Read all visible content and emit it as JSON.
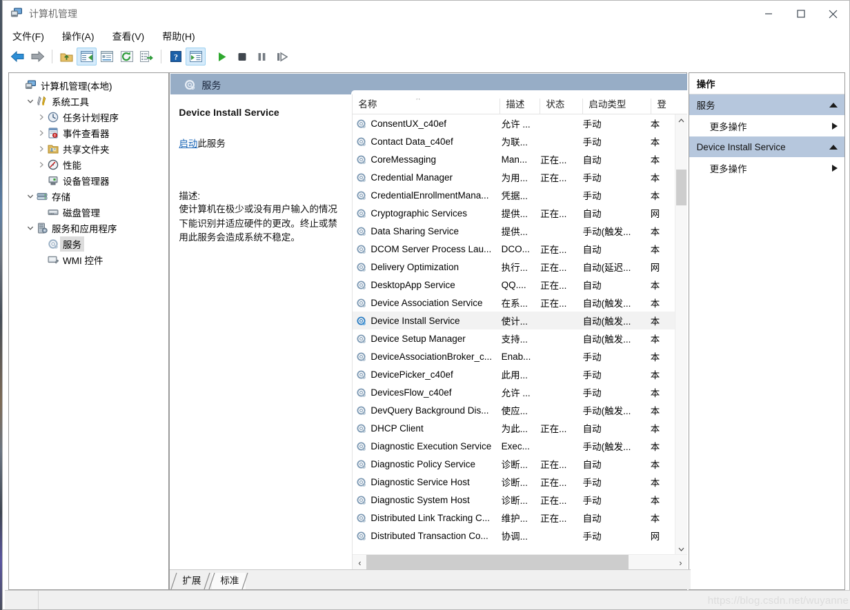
{
  "window": {
    "title": "计算机管理",
    "icon": "computer-management-icon",
    "controls": {
      "minimize": "最小化",
      "maximize": "最大化",
      "close": "关闭"
    }
  },
  "menubar": [
    {
      "label": "文件(F)",
      "name": "menu-file"
    },
    {
      "label": "操作(A)",
      "name": "menu-action"
    },
    {
      "label": "查看(V)",
      "name": "menu-view"
    },
    {
      "label": "帮助(H)",
      "name": "menu-help"
    }
  ],
  "toolbar": [
    {
      "name": "back-icon",
      "title": "后退"
    },
    {
      "name": "forward-icon",
      "title": "前进"
    },
    {
      "name": "up-folder-icon",
      "title": "向上一级"
    },
    {
      "name": "show-tree-icon",
      "title": "显示/隐藏控制台树",
      "pressed": true
    },
    {
      "name": "properties-icon",
      "title": "属性"
    },
    {
      "name": "refresh-icon",
      "title": "刷新"
    },
    {
      "name": "export-list-icon",
      "title": "导出列表"
    },
    {
      "name": "help-icon",
      "title": "帮助"
    },
    {
      "name": "show-action-pane-icon",
      "title": "显示/隐藏操作窗格",
      "pressed": true
    },
    {
      "name": "start-service-icon",
      "title": "启动服务"
    },
    {
      "name": "stop-service-icon",
      "title": "停止服务"
    },
    {
      "name": "pause-service-icon",
      "title": "暂停服务"
    },
    {
      "name": "restart-service-icon",
      "title": "重启服务"
    }
  ],
  "tree": [
    {
      "label": "计算机管理(本地)",
      "level": 0,
      "twist": "none",
      "icon": "computer-icon",
      "selected": false
    },
    {
      "label": "系统工具",
      "level": 1,
      "twist": "expanded",
      "icon": "system-tools-icon",
      "selected": false
    },
    {
      "label": "任务计划程序",
      "level": 2,
      "twist": "collapsed",
      "icon": "task-scheduler-icon",
      "selected": false
    },
    {
      "label": "事件查看器",
      "level": 2,
      "twist": "collapsed",
      "icon": "event-viewer-icon",
      "selected": false
    },
    {
      "label": "共享文件夹",
      "level": 2,
      "twist": "collapsed",
      "icon": "shared-folders-icon",
      "selected": false
    },
    {
      "label": "性能",
      "level": 2,
      "twist": "collapsed",
      "icon": "performance-icon",
      "selected": false
    },
    {
      "label": "设备管理器",
      "level": 2,
      "twist": "none",
      "icon": "device-manager-icon",
      "selected": false
    },
    {
      "label": "存储",
      "level": 1,
      "twist": "expanded",
      "icon": "storage-icon",
      "selected": false
    },
    {
      "label": "磁盘管理",
      "level": 2,
      "twist": "none",
      "icon": "disk-management-icon",
      "selected": false
    },
    {
      "label": "服务和应用程序",
      "level": 1,
      "twist": "expanded",
      "icon": "services-apps-icon",
      "selected": false
    },
    {
      "label": "服务",
      "level": 2,
      "twist": "none",
      "icon": "services-icon",
      "selected": true
    },
    {
      "label": "WMI 控件",
      "level": 2,
      "twist": "none",
      "icon": "wmi-control-icon",
      "selected": false
    }
  ],
  "center": {
    "band_title": "服务",
    "detail": {
      "service_name": "Device Install Service",
      "action_link": "启动",
      "action_suffix": "此服务",
      "desc_header": "描述:",
      "desc_body": "使计算机在极少或没有用户输入的情况下能识别并适应硬件的更改。终止或禁用此服务会造成系统不稳定。"
    },
    "columns": [
      "名称",
      "描述",
      "状态",
      "启动类型",
      "登"
    ],
    "sort": {
      "column": "名称",
      "direction": "ascending",
      "marker": "^"
    },
    "rows": [
      {
        "name": "ConsentUX_c40ef",
        "desc": "允许 ...",
        "status": "",
        "startup": "手动",
        "logon": "本",
        "selected": false
      },
      {
        "name": "Contact Data_c40ef",
        "desc": "为联...",
        "status": "",
        "startup": "手动",
        "logon": "本",
        "selected": false
      },
      {
        "name": "CoreMessaging",
        "desc": "Man...",
        "status": "正在...",
        "startup": "自动",
        "logon": "本",
        "selected": false
      },
      {
        "name": "Credential Manager",
        "desc": "为用...",
        "status": "正在...",
        "startup": "手动",
        "logon": "本",
        "selected": false
      },
      {
        "name": "CredentialEnrollmentMana...",
        "desc": "凭据...",
        "status": "",
        "startup": "手动",
        "logon": "本",
        "selected": false
      },
      {
        "name": "Cryptographic Services",
        "desc": "提供...",
        "status": "正在...",
        "startup": "自动",
        "logon": "网",
        "selected": false
      },
      {
        "name": "Data Sharing Service",
        "desc": "提供...",
        "status": "",
        "startup": "手动(触发...",
        "logon": "本",
        "selected": false
      },
      {
        "name": "DCOM Server Process Lau...",
        "desc": "DCO...",
        "status": "正在...",
        "startup": "自动",
        "logon": "本",
        "selected": false
      },
      {
        "name": "Delivery Optimization",
        "desc": "执行...",
        "status": "正在...",
        "startup": "自动(延迟...",
        "logon": "网",
        "selected": false
      },
      {
        "name": "DesktopApp Service",
        "desc": "QQ....",
        "status": "正在...",
        "startup": "自动",
        "logon": "本",
        "selected": false
      },
      {
        "name": "Device Association Service",
        "desc": "在系...",
        "status": "正在...",
        "startup": "自动(触发...",
        "logon": "本",
        "selected": false
      },
      {
        "name": "Device Install Service",
        "desc": "使计...",
        "status": "",
        "startup": "自动(触发...",
        "logon": "本",
        "selected": true
      },
      {
        "name": "Device Setup Manager",
        "desc": "支持...",
        "status": "",
        "startup": "自动(触发...",
        "logon": "本",
        "selected": false
      },
      {
        "name": "DeviceAssociationBroker_c...",
        "desc": "Enab...",
        "status": "",
        "startup": "手动",
        "logon": "本",
        "selected": false
      },
      {
        "name": "DevicePicker_c40ef",
        "desc": "此用...",
        "status": "",
        "startup": "手动",
        "logon": "本",
        "selected": false
      },
      {
        "name": "DevicesFlow_c40ef",
        "desc": "允许 ...",
        "status": "",
        "startup": "手动",
        "logon": "本",
        "selected": false
      },
      {
        "name": "DevQuery Background Dis...",
        "desc": "使应...",
        "status": "",
        "startup": "手动(触发...",
        "logon": "本",
        "selected": false
      },
      {
        "name": "DHCP Client",
        "desc": "为此...",
        "status": "正在...",
        "startup": "自动",
        "logon": "本",
        "selected": false
      },
      {
        "name": "Diagnostic Execution Service",
        "desc": "Exec...",
        "status": "",
        "startup": "手动(触发...",
        "logon": "本",
        "selected": false
      },
      {
        "name": "Diagnostic Policy Service",
        "desc": "诊断...",
        "status": "正在...",
        "startup": "自动",
        "logon": "本",
        "selected": false
      },
      {
        "name": "Diagnostic Service Host",
        "desc": "诊断...",
        "status": "正在...",
        "startup": "手动",
        "logon": "本",
        "selected": false
      },
      {
        "name": "Diagnostic System Host",
        "desc": "诊断...",
        "status": "正在...",
        "startup": "手动",
        "logon": "本",
        "selected": false
      },
      {
        "name": "Distributed Link Tracking C...",
        "desc": "维护...",
        "status": "正在...",
        "startup": "自动",
        "logon": "本",
        "selected": false
      },
      {
        "name": "Distributed Transaction Co...",
        "desc": "协调...",
        "status": "",
        "startup": "手动",
        "logon": "网",
        "selected": false
      }
    ],
    "tabs": [
      {
        "label": "扩展",
        "active": false,
        "name": "tab-extended"
      },
      {
        "label": "标准",
        "active": true,
        "name": "tab-standard"
      }
    ]
  },
  "actions": {
    "title": "操作",
    "groups": [
      {
        "header": "服务",
        "collapse": "▲",
        "items": [
          {
            "label": "更多操作",
            "arrow": "▶"
          }
        ]
      },
      {
        "header": "Device Install Service",
        "collapse": "▲",
        "items": [
          {
            "label": "更多操作",
            "arrow": "▶"
          }
        ]
      }
    ]
  },
  "watermark": "https://blog.csdn.net/wuyanne",
  "colors": {
    "band": "#97adc6",
    "action_group": "#b6c7dd",
    "link": "#1763b5",
    "selection": "#f2f2f2",
    "tree_selection": "#dcdcdc"
  }
}
